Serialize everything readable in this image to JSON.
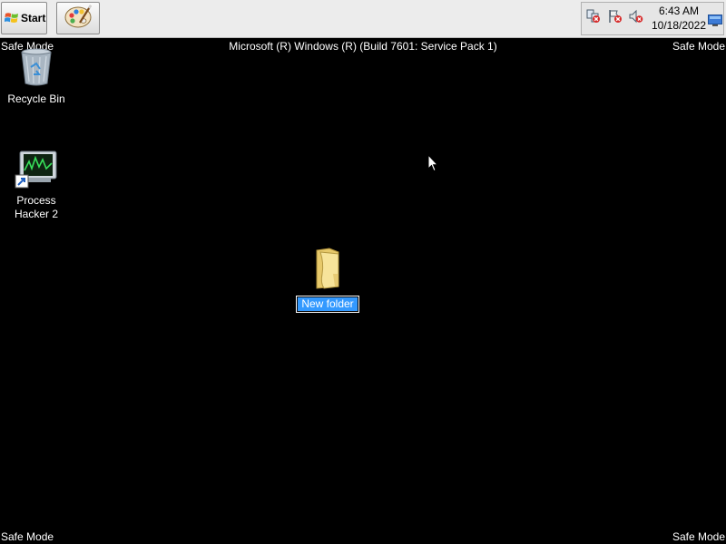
{
  "taskbar": {
    "start_label": "Start",
    "pinned": [
      {
        "icon": "paint-palette-icon"
      }
    ],
    "tray_icons": [
      "network-disconnected-icon",
      "action-center-error-icon",
      "volume-muted-icon"
    ],
    "clock": {
      "time": "6:43 AM",
      "date": "10/18/2022"
    },
    "show_desktop_icon": "show-desktop-icon"
  },
  "overlay": {
    "safe_mode_label": "Safe Mode",
    "build_text": "Microsoft (R) Windows (R) (Build 7601: Service Pack 1)"
  },
  "desktop": {
    "icons": [
      {
        "label": "Recycle Bin",
        "icon": "recycle-bin-icon"
      },
      {
        "label_line1": "Process",
        "label_line2": "Hacker 2",
        "icon": "process-hacker-icon"
      },
      {
        "label": "New folder",
        "icon": "folder-icon",
        "renaming": true
      }
    ]
  },
  "colors": {
    "desktop_bg": "#000000",
    "taskbar_bg": "#ececec",
    "selection_bg": "#3399ff",
    "overlay_text": "#ffffff"
  }
}
